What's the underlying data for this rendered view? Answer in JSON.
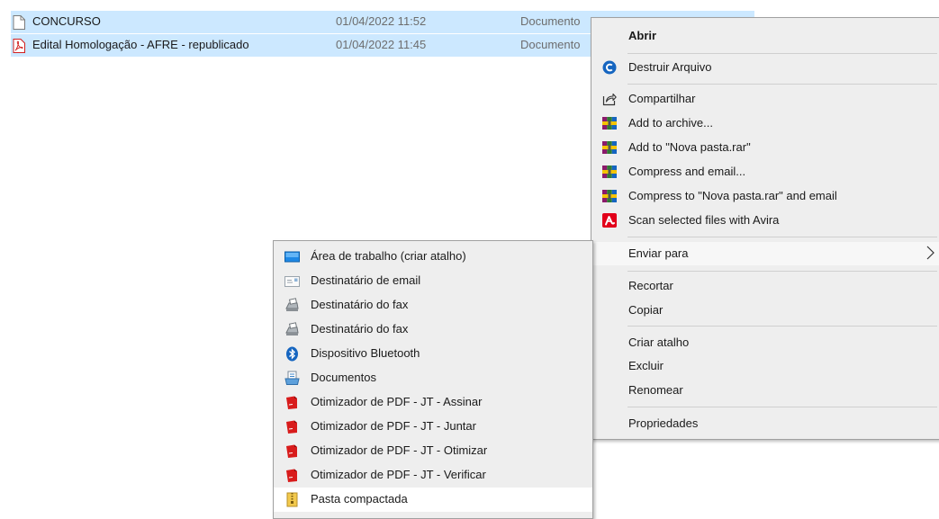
{
  "files": [
    {
      "name": "CONCURSO",
      "date": "01/04/2022 11:52",
      "type": "Documento",
      "icon": "blank-document-icon"
    },
    {
      "name": "Edital Homologação - AFRE - republicado",
      "date": "01/04/2022 11:45",
      "type": "Documento",
      "icon": "pdf-icon"
    }
  ],
  "context_menu": {
    "open": "Abrir",
    "destroy": "Destruir Arquivo",
    "share": "Compartilhar",
    "add_archive": "Add to archive...",
    "add_rar": "Add to \"Nova pasta.rar\"",
    "compress_email": "Compress and email...",
    "compress_rar_email": "Compress to \"Nova pasta.rar\" and email",
    "scan_avira": "Scan selected files with Avira",
    "send_to": "Enviar para",
    "cut": "Recortar",
    "copy": "Copiar",
    "create_shortcut": "Criar atalho",
    "delete": "Excluir",
    "rename": "Renomear",
    "properties": "Propriedades"
  },
  "send_to_menu": {
    "items": [
      {
        "label": "Área de trabalho (criar atalho)",
        "icon": "desktop-icon"
      },
      {
        "label": "Destinatário de email",
        "icon": "mail-icon"
      },
      {
        "label": "Destinatário do fax",
        "icon": "fax-icon"
      },
      {
        "label": "Destinatário do fax",
        "icon": "fax-icon"
      },
      {
        "label": "Dispositivo Bluetooth",
        "icon": "bluetooth-icon"
      },
      {
        "label": "Documentos",
        "icon": "documents-icon"
      },
      {
        "label": "Otimizador de PDF - JT - Assinar",
        "icon": "pdf-optimizer-icon"
      },
      {
        "label": "Otimizador de PDF - JT - Juntar",
        "icon": "pdf-optimizer-icon"
      },
      {
        "label": "Otimizador de PDF - JT - Otimizar",
        "icon": "pdf-optimizer-icon"
      },
      {
        "label": "Otimizador de PDF - JT - Verificar",
        "icon": "pdf-optimizer-icon"
      },
      {
        "label": "Pasta compactada",
        "icon": "zip-folder-icon"
      }
    ]
  },
  "colors": {
    "selection": "#cce8ff",
    "menu_bg": "#eeeeee",
    "avira": "#e2001a",
    "destroy_blue": "#1565c0"
  }
}
